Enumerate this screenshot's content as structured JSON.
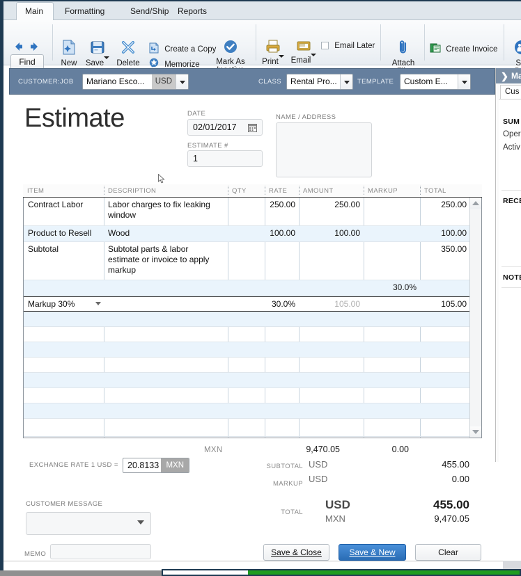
{
  "window": {
    "title": "Estimate"
  },
  "ribbon": {
    "tabs": [
      {
        "label": "Main",
        "active": true
      },
      {
        "label": "Formatting",
        "active": false
      },
      {
        "label": "Send/Ship",
        "active": false
      },
      {
        "label": "Reports",
        "active": false
      }
    ]
  },
  "toolbar": {
    "back_icon": "back-arrow-icon",
    "forward_icon": "forward-arrow-icon",
    "find_label": "Find",
    "new_label": "New",
    "save_label": "Save",
    "delete_label": "Delete",
    "create_copy_label": "Create a Copy",
    "memorize_label": "Memorize",
    "mark_inactive_label": "Mark As Inactive",
    "print_label": "Print",
    "email_label": "Email",
    "email_later_label": "Email Later",
    "attach_file_label": "Attach File",
    "create_invoice_label": "Create Invoice",
    "start_project_label": "Sta Proj"
  },
  "header_bar": {
    "customer_job_label": "CUSTOMER:JOB",
    "customer_value": "Mariano Esco...",
    "customer_currency": "USD",
    "class_label": "CLASS",
    "class_value": "Rental Pro...",
    "template_label": "TEMPLATE",
    "template_value": "Custom E..."
  },
  "form": {
    "title": "Estimate",
    "date_label": "DATE",
    "date_value": "02/01/2017",
    "estimate_num_label": "ESTIMATE #",
    "estimate_num_value": "1",
    "name_address_label": "NAME / ADDRESS",
    "name_address_value": ""
  },
  "grid": {
    "columns": [
      "ITEM",
      "DESCRIPTION",
      "QTY",
      "RATE",
      "AMOUNT",
      "MARKUP",
      "TOTAL"
    ],
    "rows": [
      {
        "item": "Contract Labor",
        "description": "Labor charges to fix leaking window",
        "qty": "",
        "rate": "250.00",
        "amount": "250.00",
        "markup": "",
        "total": "250.00",
        "alt": false
      },
      {
        "item": "Product to Resell",
        "description": "Wood",
        "qty": "",
        "rate": "100.00",
        "amount": "100.00",
        "markup": "",
        "total": "100.00",
        "alt": true
      },
      {
        "item": "Subtotal",
        "description": "Subtotal parts & labor estimate or invoice to apply markup",
        "qty": "",
        "rate": "",
        "amount": "",
        "markup": "",
        "total": "350.00",
        "alt": false
      },
      {
        "item": "",
        "description": "",
        "qty": "",
        "rate": "",
        "amount": "",
        "markup": "30.0%",
        "total": "",
        "alt": true
      }
    ],
    "selected_row": {
      "item": "Markup 30%",
      "description": "",
      "qty": "",
      "rate": "30.0%",
      "amount": "105.00",
      "markup": "",
      "total": "105.00"
    }
  },
  "totals": {
    "mxn_label": "MXN",
    "mxn_amount": "9,470.05",
    "mxn_markup": "0.00",
    "subtotal_label": "SUBTOTAL",
    "subtotal_currency": "USD",
    "subtotal_value": "455.00",
    "markup_label": "MARKUP",
    "markup_currency": "USD",
    "markup_value": "0.00",
    "total_label": "TOTAL",
    "total_currency": "USD",
    "total_value": "455.00",
    "total_alt_currency": "MXN",
    "total_alt_value": "9,470.05"
  },
  "bottom": {
    "exchange_rate_label": "EXCHANGE RATE 1 USD =",
    "exchange_rate_value": "20.8133",
    "exchange_rate_currency": "MXN",
    "customer_message_label": "CUSTOMER MESSAGE",
    "customer_message_value": "",
    "memo_label": "MEMO",
    "memo_value": "",
    "save_close_label": "Save & Close",
    "save_new_label": "Save & New",
    "clear_label": "Clear"
  },
  "sidebar": {
    "chevron_icon": "chevron-right-icon",
    "title": "Ma",
    "tab_label": "Cus",
    "section_summary": "SUM",
    "summary_line1": "Oper",
    "summary_line2": "Activ",
    "section_recent": "RECE",
    "section_notes": "NOTE"
  },
  "colors": {
    "header_blue": "#657f9e",
    "primary_button": "#2a6db5",
    "window_border": "#1e3a52",
    "row_alt": "#eaf4fc",
    "status_green": "#1f9c1f"
  }
}
